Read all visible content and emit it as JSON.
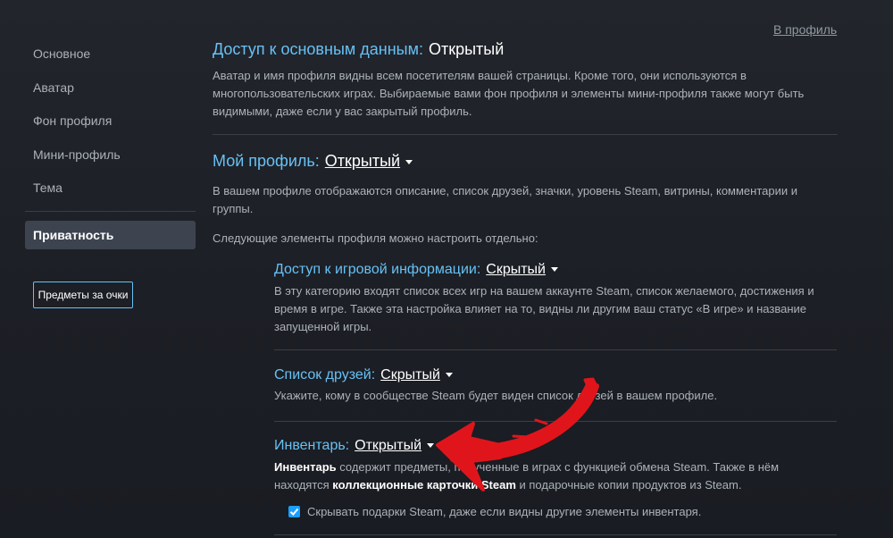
{
  "sidebar": {
    "items": [
      {
        "label": "Основное"
      },
      {
        "label": "Аватар"
      },
      {
        "label": "Фон профиля"
      },
      {
        "label": "Мини-профиль"
      },
      {
        "label": "Тема"
      }
    ],
    "active_item": {
      "label": "Приватность"
    },
    "items_button": "Предметы за очки"
  },
  "header": {
    "profile_link": "В профиль"
  },
  "basic": {
    "title": "Доступ к основным данным:",
    "value": "Открытый",
    "description": "Аватар и имя профиля видны всем посетителям вашей страницы. Кроме того, они используются в многопользовательских играх. Выбираемые вами фон профиля и элементы мини-профиля также могут быть видимыми, даже если у вас закрытый профиль."
  },
  "my_profile": {
    "title": "Мой профиль:",
    "value": "Открытый",
    "description": "В вашем профиле отображаются описание, список друзей, значки, уровень Steam, витрины, комментарии и группы.",
    "note": "Следующие элементы профиля можно настроить отдельно:"
  },
  "game_info": {
    "title": "Доступ к игровой информации:",
    "value": "Скрытый",
    "description": "В эту категорию входят список всех игр на вашем аккаунте Steam, список желаемого, достижения и время в игре. Также эта настройка влияет на то, видны ли другим ваш статус «В игре» и название запущенной игры."
  },
  "friends": {
    "title": "Список друзей:",
    "value": "Скрытый",
    "description": "Укажите, кому в сообществе Steam будет виден список друзей в вашем профиле."
  },
  "inventory": {
    "title": "Инвентарь:",
    "value": "Открытый",
    "desc_bold1": "Инвентарь",
    "desc_part1": " содержит предметы, полученные в играх с функцией обмена Steam. Также в нём находятся ",
    "desc_bold2": "коллекционные карточки Steam",
    "desc_part2": " и подарочные копии продуктов из Steam.",
    "checkbox_label": "Скрывать подарки Steam, даже если видны другие элементы инвентаря.",
    "checkbox_checked": true
  },
  "colors": {
    "accent": "#67c1f5",
    "annotation_arrow": "#e0151b",
    "checkbox": "#1a9fff"
  }
}
